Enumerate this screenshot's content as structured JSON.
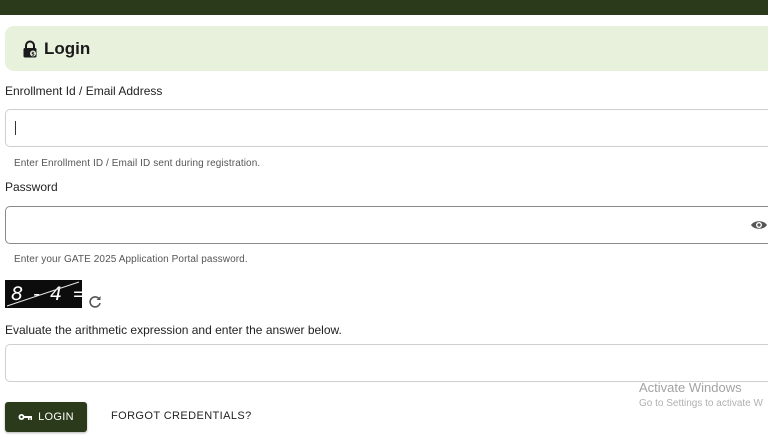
{
  "header": {
    "title": "Login"
  },
  "enrollment": {
    "label": "Enrollment Id / Email Address",
    "value": "",
    "hint": "Enter Enrollment ID / Email ID sent during registration."
  },
  "password": {
    "label": "Password",
    "value": "",
    "hint": "Enter your GATE 2025 Application Portal password."
  },
  "captcha": {
    "expression": "8 - 4 =",
    "instruction": "Evaluate the arithmetic expression and enter the answer below.",
    "answer_value": ""
  },
  "actions": {
    "login_label": "LOGIN",
    "forgot_label": "FORGOT CREDENTIALS?"
  },
  "watermark": {
    "line1": "Activate Windows",
    "line2": "Go to Settings to activate W"
  },
  "icons": {
    "header": "lock-icon",
    "password_toggle": "eye-icon",
    "captcha_refresh": "refresh-icon",
    "login": "key-icon"
  },
  "colors": {
    "top_bar": "#2b3a1b",
    "header_background": "#e8f1dc",
    "login_button": "#2b3a1b"
  }
}
